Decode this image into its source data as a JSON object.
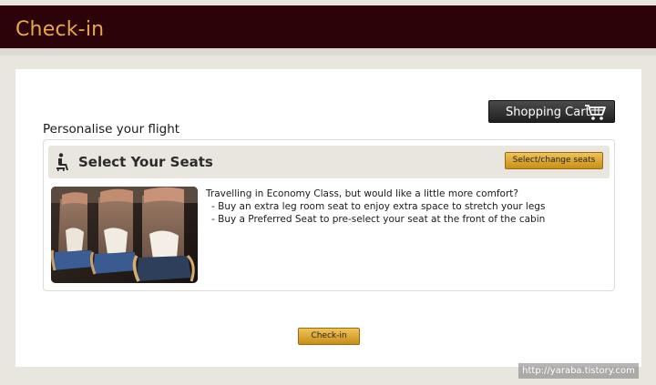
{
  "header": {
    "title": "Check-in"
  },
  "toolbar": {
    "cart_label": "Shopping Cart",
    "cart_icon": "shopping-cart-icon"
  },
  "section": {
    "title": "Personalise your flight"
  },
  "seats": {
    "heading": "Select Your Seats",
    "heading_icon": "seat-icon",
    "select_button": "Select/change seats",
    "description": {
      "intro": "Travelling in Economy Class, but would like a little more comfort?",
      "bullets": [
        "- Buy an extra leg room seat to enjoy extra space to stretch your legs",
        "- Buy a Preferred Seat to pre-select your seat at the front of the cabin"
      ]
    }
  },
  "footer": {
    "checkin_button": "Check-in"
  },
  "watermark": "http://yaraba.tistory.com",
  "colors": {
    "header_bg": "#2c0308",
    "header_text": "#e7a74a",
    "button_gold": "#d9a331",
    "page_bg": "#e9e6df"
  }
}
